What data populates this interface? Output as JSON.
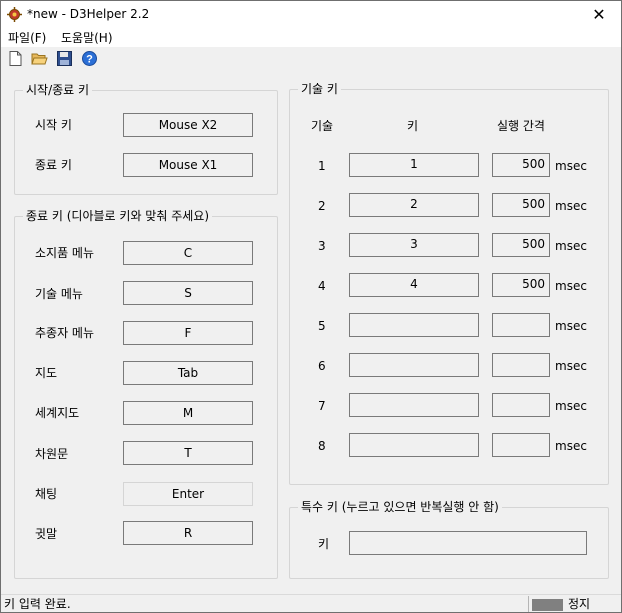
{
  "window": {
    "title": "*new - D3Helper 2.2",
    "close_icon": "close-icon"
  },
  "menu": [
    {
      "label": "파일(F)"
    },
    {
      "label": "도움말(H)"
    }
  ],
  "toolbar": {
    "icons": [
      "new-file-icon",
      "open-folder-icon",
      "save-disk-icon",
      "help-icon"
    ]
  },
  "start_stop": {
    "title": "시작/종료 키",
    "rows": [
      {
        "label": "시작 키",
        "value": "Mouse X2"
      },
      {
        "label": "종료 키",
        "value": "Mouse X1"
      }
    ]
  },
  "close_keys": {
    "title": "종료 키 (디아블로 키와 맞춰 주세요)",
    "rows": [
      {
        "label": "소지품 메뉴",
        "value": "C"
      },
      {
        "label": "기술 메뉴",
        "value": "S"
      },
      {
        "label": "추종자 메뉴",
        "value": "F"
      },
      {
        "label": "지도",
        "value": "Tab"
      },
      {
        "label": "세계지도",
        "value": "M"
      },
      {
        "label": "차원문",
        "value": "T"
      },
      {
        "label": "채팅",
        "value": "Enter"
      },
      {
        "label": "귓말",
        "value": "R"
      }
    ]
  },
  "skill_keys": {
    "title": "기술 키",
    "headers": {
      "skill": "기술",
      "key": "키",
      "interval": "실행 간격"
    },
    "unit": "msec",
    "rows": [
      {
        "num": "1",
        "key": "1",
        "interval": "500"
      },
      {
        "num": "2",
        "key": "2",
        "interval": "500"
      },
      {
        "num": "3",
        "key": "3",
        "interval": "500"
      },
      {
        "num": "4",
        "key": "4",
        "interval": "500"
      },
      {
        "num": "5",
        "key": "",
        "interval": ""
      },
      {
        "num": "6",
        "key": "",
        "interval": ""
      },
      {
        "num": "7",
        "key": "",
        "interval": ""
      },
      {
        "num": "8",
        "key": "",
        "interval": ""
      }
    ]
  },
  "special_key": {
    "title": "특수 키 (누르고 있으면 반복실행 안 함)",
    "label": "키",
    "value": ""
  },
  "status": {
    "message": "키 입력 완료.",
    "state": "정지",
    "indicator_color": "#808080"
  }
}
